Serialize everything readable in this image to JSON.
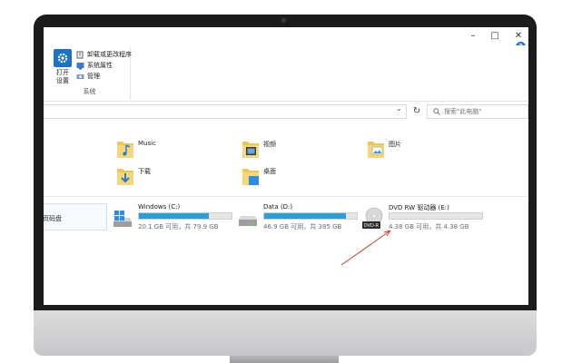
{
  "ribbon": {
    "open_settings_line1": "打开",
    "open_settings_line2": "设置",
    "uninstall_label": "卸载或更改程序",
    "sysprops_label": "系统属性",
    "manage_label": "管理",
    "group_label": "系统"
  },
  "window": {
    "minimize": "–",
    "maximize": "□",
    "close": "✕",
    "collapse": "︿",
    "help": "?"
  },
  "address": {
    "dropdown": "⌄",
    "refresh": "↻",
    "search_placeholder": "搜索\"此电脑\""
  },
  "folders": [
    {
      "name": "Music",
      "icon": "music-folder-icon"
    },
    {
      "name": "视频",
      "icon": "video-folder-icon"
    },
    {
      "name": "图片",
      "icon": "pictures-folder-icon"
    },
    {
      "name": "下载",
      "icon": "downloads-folder-icon"
    },
    {
      "name": "桌面",
      "icon": "desktop-folder-icon"
    }
  ],
  "nav_partial": "页码盘",
  "drives": [
    {
      "name": "Windows (C:)",
      "info": "20.1 GB 可用，共 79.9 GB",
      "used_fraction": 0.75,
      "icon": "windows-drive-icon"
    },
    {
      "name": "Data (D:)",
      "info": "46.9 GB 可用，共 385 GB",
      "used_fraction": 0.88,
      "icon": "hard-drive-icon"
    },
    {
      "name": "DVD RW 驱动器 (E:)",
      "info": "4.38 GB 可用，共 4.38 GB",
      "used_fraction": 0.0,
      "icon": "dvd-drive-icon",
      "icon_text": "DVD-R"
    }
  ],
  "colors": {
    "accent": "#26a0da",
    "bezel": "#1b1b1b",
    "arrow": "#d63a2e"
  }
}
